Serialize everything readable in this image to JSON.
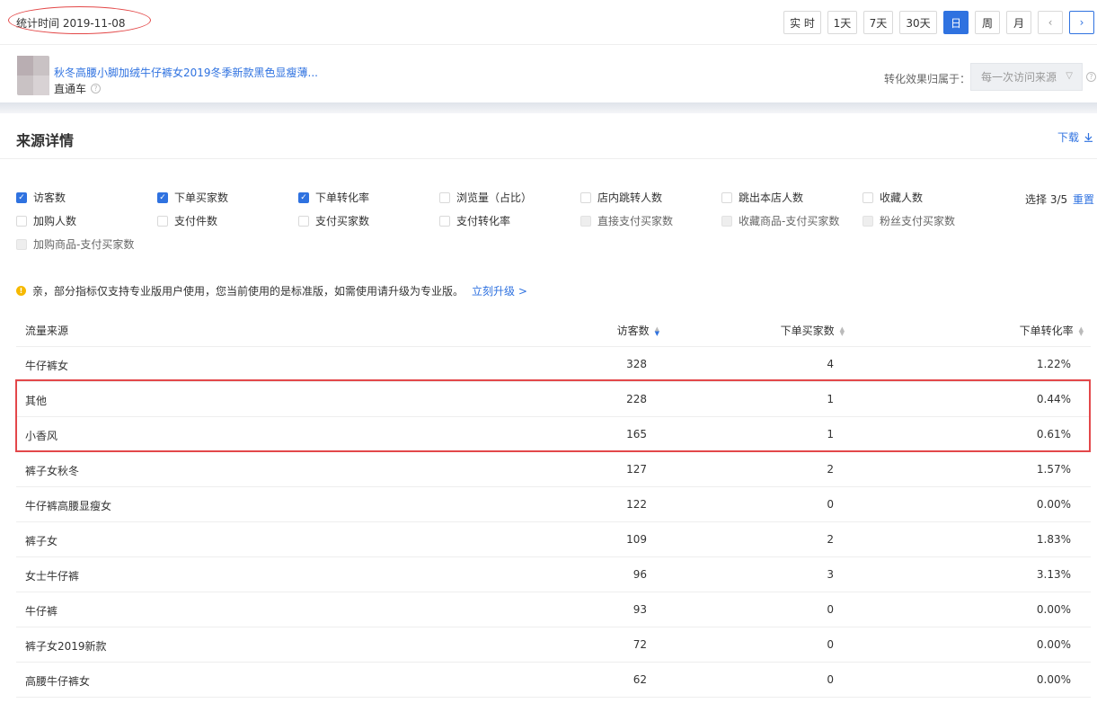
{
  "header": {
    "stat_time": "统计时间 2019-11-08",
    "periods": [
      {
        "label": "实 时",
        "active": false
      },
      {
        "label": "1天",
        "active": false
      },
      {
        "label": "7天",
        "active": false
      },
      {
        "label": "30天",
        "active": false
      },
      {
        "label": "日",
        "active": true
      },
      {
        "label": "周",
        "active": false
      },
      {
        "label": "月",
        "active": false
      }
    ],
    "prev_glyph": "‹",
    "next_glyph": "›"
  },
  "product": {
    "title": "秋冬高腰小脚加绒牛仔裤女2019冬季新款黑色显瘦薄...",
    "channel": "直通车",
    "attribution_label": "转化效果归属于：",
    "attribution_value": "每一次访问来源"
  },
  "section": {
    "title": "来源详情",
    "download": "下载"
  },
  "metrics": {
    "items": [
      {
        "label": "访客数",
        "state": "checked"
      },
      {
        "label": "下单买家数",
        "state": "checked"
      },
      {
        "label": "下单转化率",
        "state": "checked"
      },
      {
        "label": "浏览量（占比）",
        "state": "unchecked"
      },
      {
        "label": "店内跳转人数",
        "state": "unchecked"
      },
      {
        "label": "跳出本店人数",
        "state": "unchecked"
      },
      {
        "label": "收藏人数",
        "state": "unchecked"
      },
      {
        "label": "加购人数",
        "state": "unchecked"
      },
      {
        "label": "支付件数",
        "state": "unchecked"
      },
      {
        "label": "支付买家数",
        "state": "unchecked"
      },
      {
        "label": "支付转化率",
        "state": "unchecked"
      },
      {
        "label": "直接支付买家数",
        "state": "disabled"
      },
      {
        "label": "收藏商品-支付买家数",
        "state": "disabled"
      },
      {
        "label": "粉丝支付买家数",
        "state": "disabled"
      },
      {
        "label": "加购商品-支付买家数",
        "state": "disabled"
      }
    ],
    "select_count": "选择 3/5",
    "reset": "重置"
  },
  "notice": {
    "text": "亲，部分指标仅支持专业版用户使用，您当前使用的是标准版，如需使用请升级为专业版。",
    "link": "立刻升级 >"
  },
  "table": {
    "columns": [
      "流量来源",
      "访客数",
      "下单买家数",
      "下单转化率"
    ],
    "sorted_column": "访客数",
    "rows": [
      [
        "牛仔裤女",
        "328",
        "4",
        "1.22%"
      ],
      [
        "其他",
        "228",
        "1",
        "0.44%"
      ],
      [
        "小香风",
        "165",
        "1",
        "0.61%"
      ],
      [
        "裤子女秋冬",
        "127",
        "2",
        "1.57%"
      ],
      [
        "牛仔裤高腰显瘦女",
        "122",
        "0",
        "0.00%"
      ],
      [
        "裤子女",
        "109",
        "2",
        "1.83%"
      ],
      [
        "女士牛仔裤",
        "96",
        "3",
        "3.13%"
      ],
      [
        "牛仔裤",
        "93",
        "0",
        "0.00%"
      ],
      [
        "裤子女2019新款",
        "72",
        "0",
        "0.00%"
      ],
      [
        "高腰牛仔裤女",
        "62",
        "0",
        "0.00%"
      ]
    ],
    "highlighted_rows": [
      "其他",
      "小香风"
    ]
  },
  "colors": {
    "accent": "#2f72e0",
    "annotation": "#e3474a",
    "warning": "#f6b900"
  }
}
